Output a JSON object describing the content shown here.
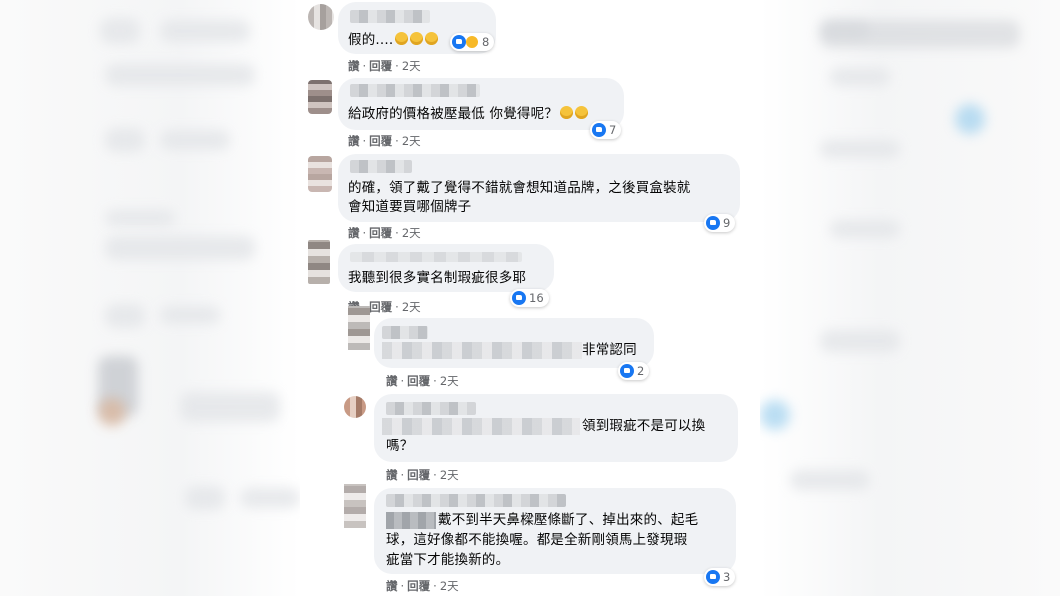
{
  "comments": [
    {
      "text": "假的....",
      "emoji_count": 3,
      "reactions": "8",
      "has_haha": true,
      "actions": {
        "like": "讚",
        "reply": "回覆",
        "time": "2天"
      }
    },
    {
      "text": "給政府的價格被壓最低 你覺得呢？",
      "emoji_count": 2,
      "reactions": "7",
      "has_haha": false,
      "actions": {
        "like": "讚",
        "reply": "回覆",
        "time": "2天"
      }
    },
    {
      "text_line1": "的確，領了戴了覺得不錯就會想知道品牌，之後買盒裝就",
      "text_line2": "會知道要買哪個牌子",
      "reactions": "9",
      "actions": {
        "like": "讚",
        "reply": "回覆",
        "time": "2天"
      }
    },
    {
      "text": "我聽到很多實名制瑕疵很多耶",
      "reactions": "16",
      "actions": {
        "like": "讚",
        "reply": "回覆",
        "time": "2天"
      }
    }
  ],
  "replies": [
    {
      "text": "非常認同",
      "reactions": "2",
      "actions": {
        "like": "讚",
        "reply": "回覆",
        "time": "2天"
      }
    },
    {
      "text_line1": "領到瑕疵不是可以換",
      "text_line2": "嗎？",
      "actions": {
        "like": "讚",
        "reply": "回覆",
        "time": "2天"
      }
    },
    {
      "text_line1": "戴不到半天鼻樑壓條斷了、掉出來的、起毛",
      "text_line2": "球，這好像都不能換喔。都是全新剛領馬上發現瑕",
      "text_line3": "疵當下才能換新的。",
      "reactions": "3",
      "actions": {
        "like": "讚",
        "reply": "回覆",
        "time": "2天"
      }
    }
  ],
  "colors": {
    "bubble": "#f0f2f5",
    "like_blue": "#1877f2",
    "meta_gray": "#65676b"
  },
  "icons": [
    "like-icon",
    "haha-icon",
    "grinning-emoji-icon"
  ]
}
